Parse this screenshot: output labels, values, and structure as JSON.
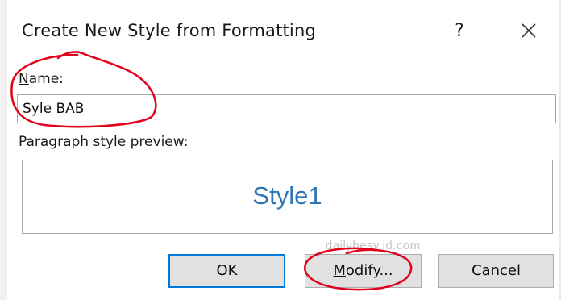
{
  "dialog": {
    "title": "Create New Style from Formatting",
    "help_label": "?",
    "close_icon": "close-icon"
  },
  "name": {
    "label_underlined": "N",
    "label_rest": "ame:",
    "value": "Syle BAB"
  },
  "preview": {
    "label": "Paragraph style preview:",
    "text": "Style1",
    "text_color": "#2e74b5"
  },
  "buttons": {
    "ok": "OK",
    "modify_underlined": "M",
    "modify_rest": "odify...",
    "cancel": "Cancel"
  },
  "watermark": "dailyhesy.id.com",
  "annotation_color": "#e2001a",
  "focus_color": "#0078d7"
}
